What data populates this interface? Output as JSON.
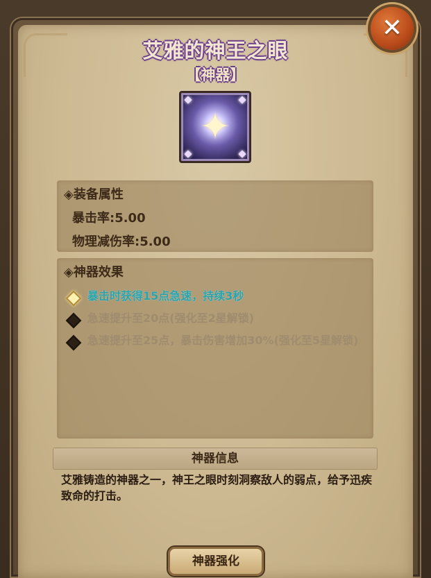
{
  "window": {
    "title": "艾雅的神王之眼",
    "subtitle": "【神器】",
    "close_icon": "close-icon"
  },
  "item": {
    "icon": "artifact-eye-icon"
  },
  "attributes": {
    "header": "◈装备属性",
    "lines": [
      "暴击率:5.00",
      "物理减伤率:5.00"
    ]
  },
  "effects": {
    "header": "◈神器效果",
    "items": [
      {
        "text": "暴击时获得15点急速，持续3秒",
        "active": true
      },
      {
        "text": "急速提升至20点(强化至2星解锁)",
        "active": false
      },
      {
        "text": "急速提升至25点，暴击伤害增加30%(强化至5星解锁)",
        "active": false
      }
    ]
  },
  "info": {
    "header": "神器信息",
    "description": "艾雅铸造的神器之一，神王之眼时刻洞察敌人的弱点，给予迅疾致命的打击。"
  },
  "footer": {
    "enhance_label": "神器强化"
  },
  "colors": {
    "active_effect": "#2ea0a8",
    "locked_effect": "#9f8c6e",
    "title_outline": "#6a3f8a"
  }
}
